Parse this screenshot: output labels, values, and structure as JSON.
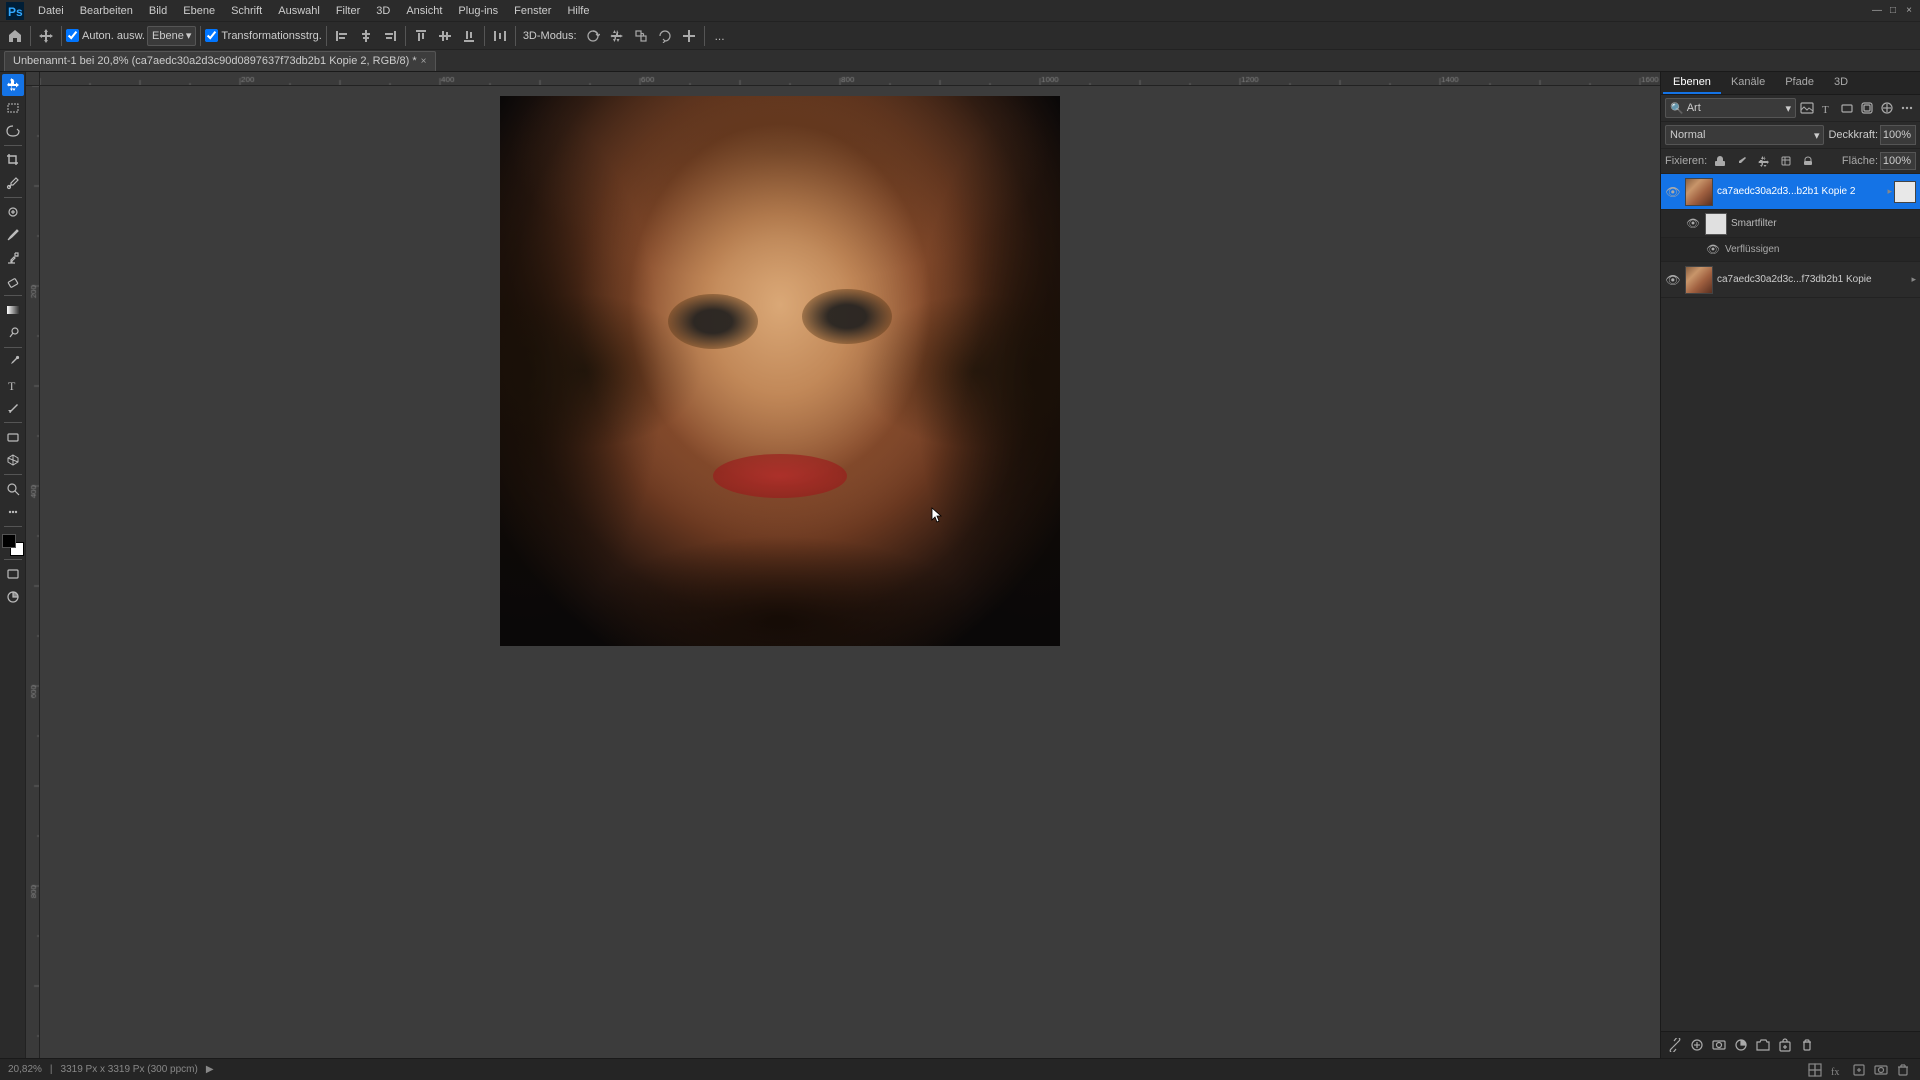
{
  "app": {
    "title": "Adobe Photoshop",
    "document_tab": "Unbenannt-1 bei 20,8% (ca7aedc30a2d3c90d0897637f73db2b1 Kopie 2, RGB/8) *"
  },
  "menubar": {
    "items": [
      "Datei",
      "Bearbeiten",
      "Bild",
      "Ebene",
      "Schrift",
      "Auswahl",
      "Filter",
      "3D",
      "Ansicht",
      "Plug-ins",
      "Fenster",
      "Hilfe"
    ],
    "window_controls": [
      "—",
      "□",
      "×"
    ]
  },
  "toolbar": {
    "autonm_label": "Auton. ausw.",
    "ebene_label": "Ebene",
    "transformstrg_label": "Transformationsstrg.",
    "mode_3d": "3D-Modus:",
    "more_label": "..."
  },
  "layers_panel": {
    "tabs": [
      "Ebenen",
      "Kanäle",
      "Pfade",
      "3D"
    ],
    "active_tab": "Ebenen",
    "search_placeholder": "Art",
    "blend_mode": "Normal",
    "opacity_label": "Deckkraft:",
    "opacity_value": "100%",
    "lock_label": "Fixieren:",
    "fill_label": "Fläche:",
    "fill_value": "100%",
    "layers": [
      {
        "id": 1,
        "name": "ca7aedc30a2d3...b2b1 Kopie 2",
        "visible": true,
        "active": true,
        "type": "smart",
        "thumbnail": "portrait",
        "sub_layers": [
          {
            "id": "sf1",
            "name": "Smartfilter",
            "visible": true,
            "type": "smartfilter_header",
            "thumbnail": "white"
          },
          {
            "id": "sf2",
            "name": "Verflüssigen",
            "visible": true,
            "type": "filter_item"
          }
        ]
      },
      {
        "id": 2,
        "name": "ca7aedc30a2d3c...f73db2b1 Kopie",
        "visible": true,
        "active": false,
        "type": "smart",
        "thumbnail": "portrait"
      }
    ]
  },
  "statusbar": {
    "zoom": "20,82%",
    "dimensions": "3319 Px x 3319 Px (300 ppcm)",
    "arrow": "▶"
  }
}
